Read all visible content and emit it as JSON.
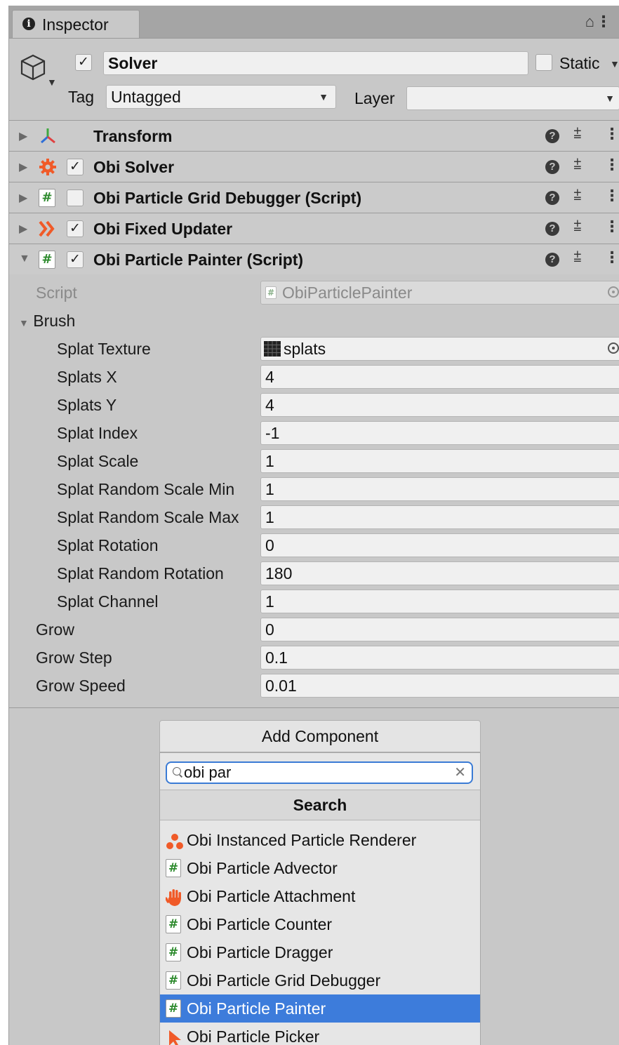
{
  "tab": {
    "title": "Inspector"
  },
  "gameobject": {
    "active": true,
    "name": "Solver",
    "static_label": "Static",
    "static": false,
    "tag_label": "Tag",
    "tag_value": "Untagged",
    "layer_label": "Layer",
    "layer_value": ""
  },
  "components": [
    {
      "name": "Transform",
      "icon": "transform-icon",
      "has_checkbox": false,
      "expanded": false
    },
    {
      "name": "Obi Solver",
      "icon": "gear-icon",
      "has_checkbox": true,
      "enabled": true,
      "expanded": false
    },
    {
      "name": "Obi Particle Grid Debugger (Script)",
      "icon": "script-icon",
      "has_checkbox": true,
      "enabled": false,
      "expanded": false
    },
    {
      "name": "Obi Fixed Updater",
      "icon": "double-chevron-icon",
      "has_checkbox": true,
      "enabled": true,
      "expanded": false
    },
    {
      "name": "Obi Particle Painter (Script)",
      "icon": "script-icon",
      "has_checkbox": true,
      "enabled": true,
      "expanded": true
    }
  ],
  "painter": {
    "script_label": "Script",
    "script_value": "ObiParticlePainter",
    "brush_label": "Brush",
    "splat_texture_label": "Splat Texture",
    "splat_texture_value": "splats",
    "props": [
      {
        "label": "Splats X",
        "value": "4"
      },
      {
        "label": "Splats Y",
        "value": "4"
      },
      {
        "label": "Splat Index",
        "value": "-1"
      },
      {
        "label": "Splat Scale",
        "value": "1"
      },
      {
        "label": "Splat Random Scale Min",
        "value": "1"
      },
      {
        "label": "Splat Random Scale Max",
        "value": "1"
      },
      {
        "label": "Splat Rotation",
        "value": "0"
      },
      {
        "label": "Splat Random Rotation",
        "value": "180"
      },
      {
        "label": "Splat Channel",
        "value": "1"
      }
    ],
    "grow_label": "Grow",
    "grow_value": "0",
    "grow_step_label": "Grow Step",
    "grow_step_value": "0.1",
    "grow_speed_label": "Grow Speed",
    "grow_speed_value": "0.01"
  },
  "add_component": {
    "button_label": "Add Component",
    "search_value": "obi par",
    "search_header": "Search",
    "results": [
      {
        "label": "Obi Instanced Particle Renderer",
        "icon": "particles-icon",
        "selected": false
      },
      {
        "label": "Obi Particle Advector",
        "icon": "script-icon",
        "selected": false
      },
      {
        "label": "Obi Particle Attachment",
        "icon": "hand-icon",
        "selected": false
      },
      {
        "label": "Obi Particle Counter",
        "icon": "script-icon",
        "selected": false
      },
      {
        "label": "Obi Particle Dragger",
        "icon": "script-icon",
        "selected": false
      },
      {
        "label": "Obi Particle Grid Debugger",
        "icon": "script-icon",
        "selected": false
      },
      {
        "label": "Obi Particle Painter",
        "icon": "script-icon",
        "selected": true
      },
      {
        "label": "Obi Particle Picker",
        "icon": "pointer-icon",
        "selected": false
      }
    ]
  },
  "colors": {
    "accent_orange": "#f05a28",
    "script_green": "#2e8b2e",
    "selection_blue": "#3d7cdb",
    "focus_blue": "#3a7bd5"
  }
}
